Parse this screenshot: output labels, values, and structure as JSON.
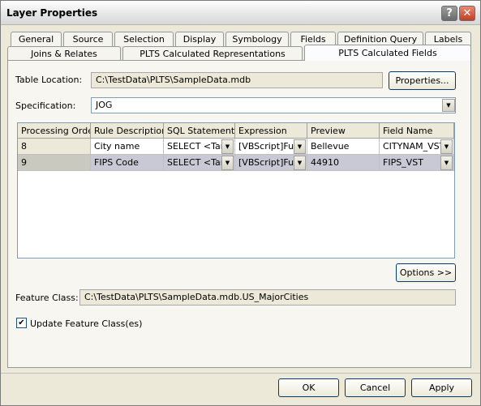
{
  "window": {
    "title": "Layer Properties"
  },
  "titlebar": {
    "help_glyph": "?",
    "close_glyph": "✕"
  },
  "tabs_row1": [
    "General",
    "Source",
    "Selection",
    "Display",
    "Symbology",
    "Fields",
    "Definition Query",
    "Labels"
  ],
  "tabs_row2": [
    "Joins & Relates",
    "PLTS Calculated Representations",
    "PLTS Calculated Fields"
  ],
  "active_tab": "PLTS Calculated Fields",
  "table_location": {
    "label": "Table Location:",
    "value": "C:\\TestData\\PLTS\\SampleData.mdb",
    "button": "Properties..."
  },
  "specification": {
    "label": "Specification:",
    "value": "JOG"
  },
  "grid": {
    "columns": [
      "Processing Order",
      "Rule Description",
      "SQL Statement",
      "Expression",
      "Preview",
      "Field Name"
    ],
    "rows": [
      {
        "order": "8",
        "rule": "City name",
        "sql": "SELECT <Tar",
        "expr": "[VBScript]Fun",
        "preview": "Bellevue",
        "field": "CITYNAM_VST"
      },
      {
        "order": "9",
        "rule": "FIPS Code",
        "sql": "SELECT <Tar",
        "expr": "[VBScript]Fun",
        "preview": "44910",
        "field": "FIPS_VST"
      }
    ]
  },
  "options_button": "Options >>",
  "feature_class": {
    "label": "Feature Class:",
    "value": "C:\\TestData\\PLTS\\SampleData.mdb.US_MajorCities"
  },
  "update_checkbox": {
    "label": "Update Feature Class(es)",
    "checked": true,
    "mark": "✔"
  },
  "footer": {
    "ok": "OK",
    "cancel": "Cancel",
    "apply": "Apply"
  },
  "icons": {
    "dropdown": "dropdown-arrow-icon"
  }
}
